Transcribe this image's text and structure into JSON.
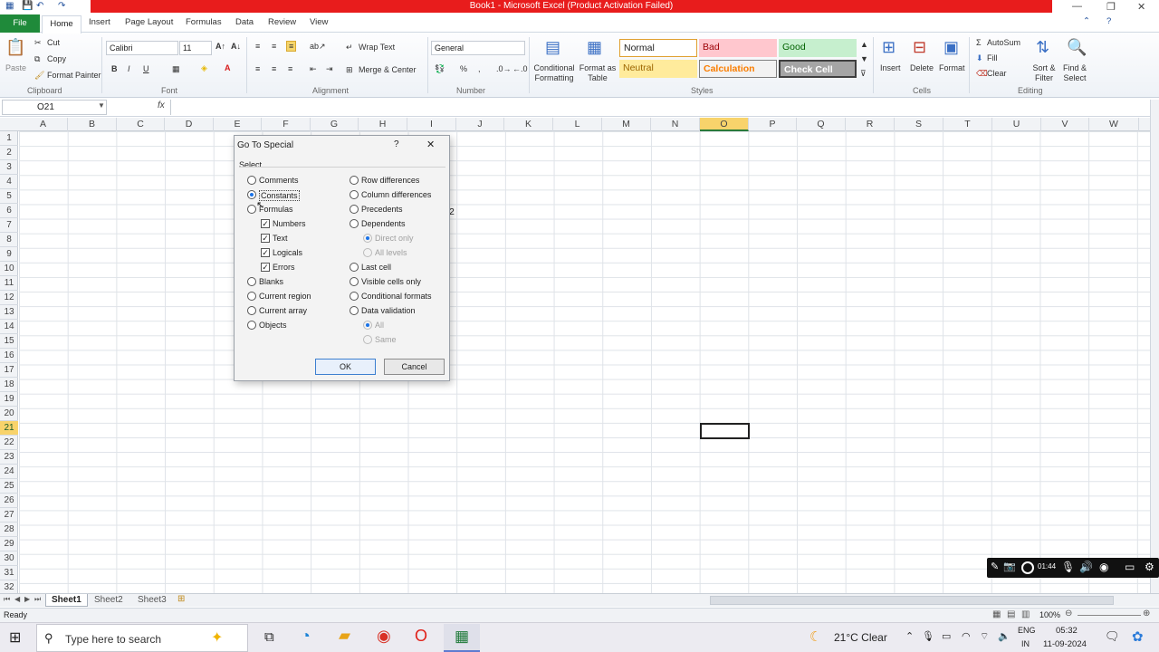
{
  "window": {
    "title": "Book1 - Microsoft Excel (Product Activation Failed)"
  },
  "ribbon_tabs": [
    "File",
    "Home",
    "Insert",
    "Page Layout",
    "Formulas",
    "Data",
    "Review",
    "View"
  ],
  "clipboard": {
    "paste": "Paste",
    "cut": "Cut",
    "copy": "Copy",
    "format_painter": "Format Painter",
    "group": "Clipboard"
  },
  "font": {
    "name": "Calibri",
    "size": "11",
    "group": "Font"
  },
  "alignment": {
    "wrap_text": "Wrap Text",
    "merge_center": "Merge & Center",
    "group": "Alignment"
  },
  "number": {
    "format": "General",
    "group": "Number"
  },
  "styles": {
    "conditional_formatting": "Conditional Formatting",
    "format_as_table": "Format as Table",
    "normal": "Normal",
    "bad": "Bad",
    "good": "Good",
    "neutral": "Neutral",
    "calculation": "Calculation",
    "check_cell": "Check Cell",
    "group": "Styles"
  },
  "cells_group": {
    "insert": "Insert",
    "delete": "Delete",
    "format": "Format",
    "group": "Cells"
  },
  "editing": {
    "autosum": "AutoSum",
    "fill": "Fill",
    "clear": "Clear",
    "sort_filter": "Sort & Filter",
    "find_select": "Find & Select",
    "group": "Editing"
  },
  "formula_bar": {
    "name_box": "O21",
    "fx": "fx",
    "value": ""
  },
  "columns": [
    "A",
    "B",
    "C",
    "D",
    "E",
    "F",
    "G",
    "H",
    "I",
    "J",
    "K",
    "L",
    "M",
    "N",
    "O",
    "P",
    "Q",
    "R",
    "S",
    "T",
    "U",
    "V",
    "W"
  ],
  "rows": [
    "1",
    "2",
    "3",
    "4",
    "5",
    "6",
    "7",
    "8",
    "9",
    "10",
    "11",
    "12",
    "13",
    "14",
    "15",
    "16",
    "17",
    "18",
    "19",
    "20",
    "21",
    "22",
    "23",
    "24",
    "25",
    "26",
    "27",
    "28",
    "29",
    "30",
    "31",
    "32"
  ],
  "cell_partial": "2",
  "dialog": {
    "title": "Go To Special",
    "help": "?",
    "close": "✕",
    "section": "Select",
    "left_options": [
      "Comments",
      "Constants",
      "Formulas",
      "Blanks",
      "Current region",
      "Current array",
      "Objects"
    ],
    "formula_subs": [
      "Numbers",
      "Text",
      "Logicals",
      "Errors"
    ],
    "right_options": [
      "Row differences",
      "Column differences",
      "Precedents",
      "Dependents",
      "Last cell",
      "Visible cells only",
      "Conditional formats",
      "Data validation"
    ],
    "dependents_subs": [
      "Direct only",
      "All levels"
    ],
    "validation_subs": [
      "All",
      "Same"
    ],
    "selected": "Constants",
    "ok": "OK",
    "cancel": "Cancel"
  },
  "sheets": [
    "Sheet1",
    "Sheet2",
    "Sheet3"
  ],
  "status": {
    "ready": "Ready",
    "zoom": "100%"
  },
  "recorder": {
    "time": "01:44"
  },
  "taskbar": {
    "search_placeholder": "Type here to search",
    "weather": "21°C  Clear",
    "lang": "ENG",
    "region": "IN",
    "time": "05:32",
    "date": "11-09-2024"
  }
}
